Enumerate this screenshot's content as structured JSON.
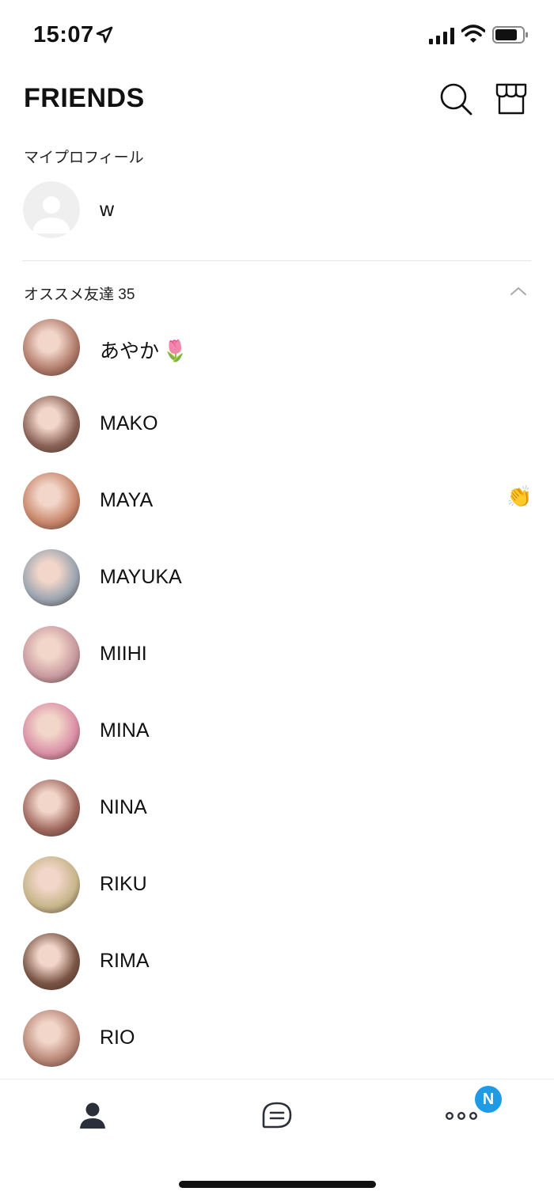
{
  "status_bar": {
    "time": "15:07"
  },
  "header": {
    "title": "FRIENDS",
    "search_icon": "search-icon",
    "store_icon": "store-icon"
  },
  "my_profile": {
    "section_label": "マイプロフィール",
    "name": "w"
  },
  "recommended": {
    "section_label": "オススメ友達 35",
    "friends": [
      {
        "name": "あやか",
        "emoji": "🌷",
        "status_emoji": "",
        "avatar_color": "#b07a6a"
      },
      {
        "name": "MAKO",
        "emoji": "",
        "status_emoji": "",
        "avatar_color": "#8a6256"
      },
      {
        "name": "MAYA",
        "emoji": "",
        "status_emoji": "👏",
        "avatar_color": "#c7856a"
      },
      {
        "name": "MAYUKA",
        "emoji": "",
        "status_emoji": "",
        "avatar_color": "#9aa4b0"
      },
      {
        "name": "MIIHI",
        "emoji": "",
        "status_emoji": "",
        "avatar_color": "#c99aa0"
      },
      {
        "name": "MINA",
        "emoji": "",
        "status_emoji": "",
        "avatar_color": "#d98fa6"
      },
      {
        "name": "NINA",
        "emoji": "",
        "status_emoji": "",
        "avatar_color": "#a0685e"
      },
      {
        "name": "RIKU",
        "emoji": "",
        "status_emoji": "",
        "avatar_color": "#c7b58a"
      },
      {
        "name": "RIMA",
        "emoji": "",
        "status_emoji": "",
        "avatar_color": "#7a5444"
      },
      {
        "name": "RIO",
        "emoji": "",
        "status_emoji": "",
        "avatar_color": "#b88676"
      }
    ]
  },
  "tab_bar": {
    "tabs": [
      {
        "icon": "person-icon",
        "active": true
      },
      {
        "icon": "chat-icon",
        "active": false
      },
      {
        "icon": "more-icon",
        "active": false
      }
    ],
    "badge": "N",
    "badge_color": "#1e9be4"
  }
}
